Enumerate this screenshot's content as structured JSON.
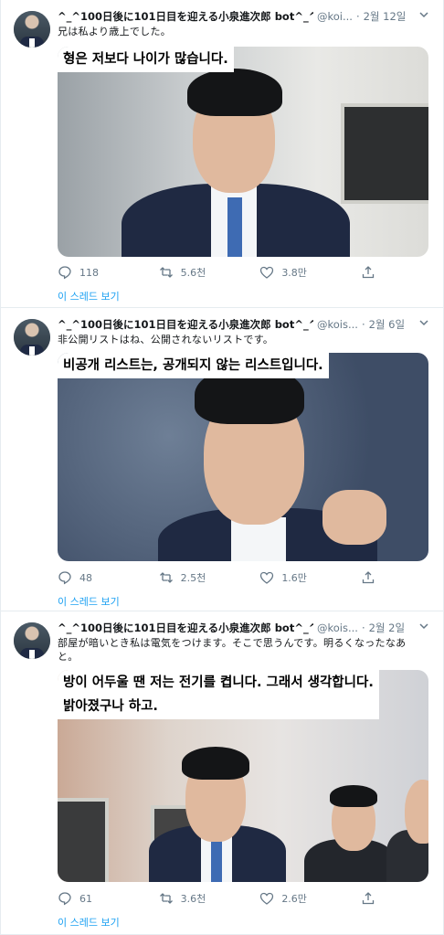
{
  "tweets": [
    {
      "name": "^_^100日後に101日目を迎える小泉進次郎 bot^_^",
      "handle": "@koi...",
      "time": "2월 12일",
      "text": "兄は私より歳上でした。",
      "caption": [
        "형은 저보다 나이가 많습니다."
      ],
      "replies": "118",
      "retweets": "5.6천",
      "likes": "3.8만",
      "thread": "이 스레드 보기"
    },
    {
      "name": "^_^100日後に101日目を迎える小泉進次郎 bot^_^",
      "handle": "@kois...",
      "time": "2월 6일",
      "text": "非公開リストはね、公開されないリストです。",
      "caption": [
        "비공개 리스트는, 공개되지 않는 리스트입니다."
      ],
      "replies": "48",
      "retweets": "2.5천",
      "likes": "1.6만",
      "thread": "이 스레드 보기"
    },
    {
      "name": "^_^100日後に101日目を迎える小泉進次郎 bot^_^",
      "handle": "@kois...",
      "time": "2월 2일",
      "text": "部屋が暗いとき私は電気をつけます。そこで思うんです。明るくなったなあと。",
      "caption": [
        "방이 어두울 땐 저는 전기를 켭니다. 그래서 생각합니다.",
        "밝아졌구나 하고."
      ],
      "replies": "61",
      "retweets": "3.6천",
      "likes": "2.6만",
      "thread": "이 스레드 보기"
    }
  ],
  "icons": {
    "reply": "reply-icon",
    "retweet": "retweet-icon",
    "like": "heart-icon",
    "share": "share-icon",
    "more": "chevron-down-icon"
  },
  "colors": {
    "link": "#1da1f2",
    "muted": "#657786",
    "border": "#e6ecf0"
  }
}
